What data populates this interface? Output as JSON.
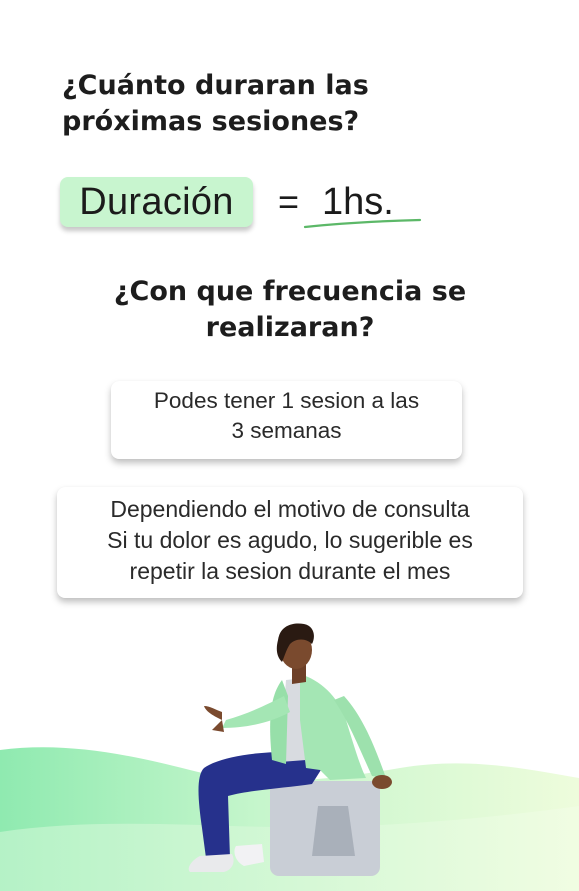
{
  "question_duration": "¿Cuánto duraran las próximas sesiones?",
  "duration": {
    "label": "Duración",
    "equals": "=",
    "value": "1hs."
  },
  "question_frequency": "¿Con que frecuencia se realizaran?",
  "card_frequency": {
    "line1": "Podes tener 1 sesion a las",
    "line2": "3 semanas"
  },
  "card_reason": {
    "line1": "Dependiendo el motivo de consulta",
    "line2": "Si tu dolor es agudo, lo sugerible es",
    "line3": "repetir la sesion durante el mes"
  },
  "colors": {
    "pill": "#c8f5cf",
    "underline": "#5cb868",
    "wave_green": "#a8f0c0",
    "wave_light": "#e6fbd8",
    "jacket": "#a4e6b4",
    "pants": "#24308a",
    "skin": "#7a4a2e",
    "hair": "#2a1a12",
    "stool": "#cbd0d7"
  },
  "illustration": "person-sitting-on-stool"
}
